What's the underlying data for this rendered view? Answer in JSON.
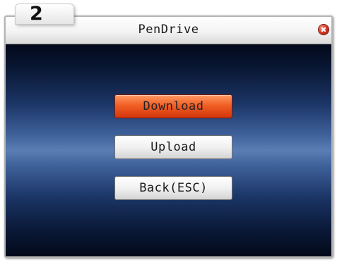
{
  "step": {
    "number": "2"
  },
  "window": {
    "title": "PenDrive"
  },
  "menu": {
    "items": [
      {
        "label": "Download",
        "selected": true
      },
      {
        "label": "Upload",
        "selected": false
      },
      {
        "label": "Back(ESC)",
        "selected": false
      }
    ]
  },
  "icons": {
    "close": "close-icon"
  },
  "colors": {
    "selected_button": "#f15f25",
    "background_top": "#03091a",
    "background_mid": "#5a7db4",
    "titlebar": "#f3f3f3"
  }
}
